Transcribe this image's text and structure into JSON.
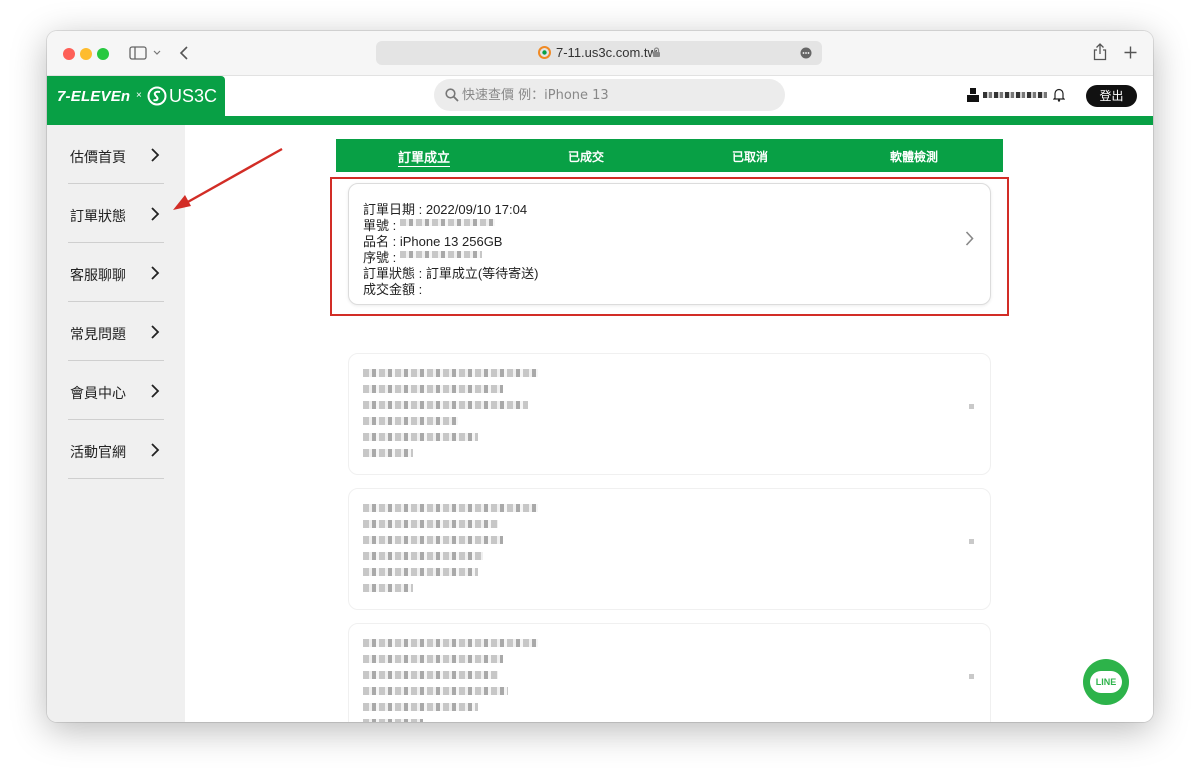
{
  "browser": {
    "url": "7-11.us3c.com.tw"
  },
  "header": {
    "logo_text": "7-ELEVEn",
    "logo_x": "×",
    "logo_brand": "US3C",
    "search_placeholder": "快速查價 例：iPhone 13",
    "logout_label": "登出"
  },
  "sidebar": {
    "items": [
      {
        "label": "估價首頁"
      },
      {
        "label": "訂單狀態"
      },
      {
        "label": "客服聊聊"
      },
      {
        "label": "常見問題"
      },
      {
        "label": "會員中心"
      },
      {
        "label": "活動官網"
      }
    ]
  },
  "tabs": [
    {
      "label": "訂單成立",
      "active": true
    },
    {
      "label": "已成交",
      "active": false
    },
    {
      "label": "已取消",
      "active": false
    },
    {
      "label": "軟體檢測",
      "active": false
    }
  ],
  "order": {
    "date": "訂單日期 : 2022/09/10 17:04",
    "number": "單號 :",
    "product": "品名 : iPhone 13 256GB",
    "serial": "序號 :",
    "status": "訂單狀態 : 訂單成立(等待寄送)",
    "amount": "成交金額 :"
  },
  "line_button": {
    "label": "LINE"
  },
  "colors": {
    "brand_green": "#08a045",
    "highlight_red": "#d22d26",
    "line_green": "#2db34a"
  }
}
